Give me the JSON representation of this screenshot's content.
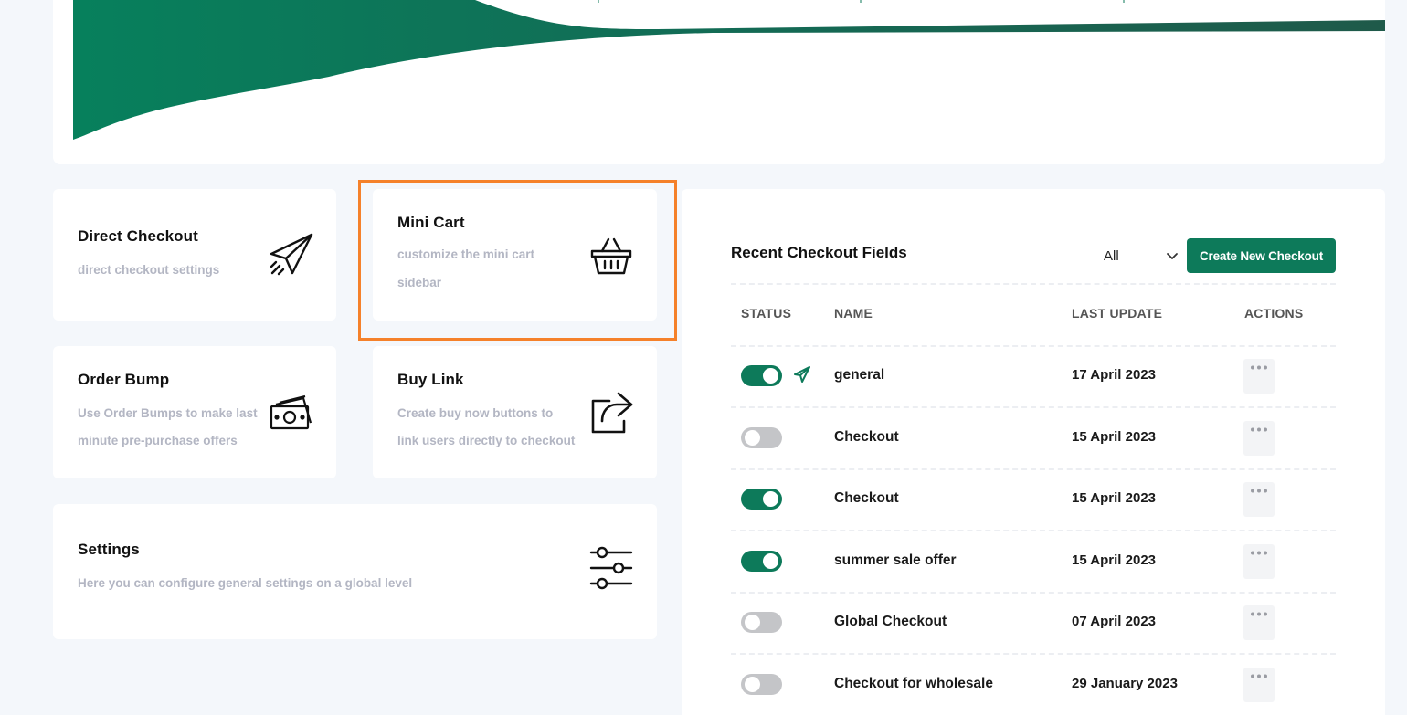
{
  "cards": {
    "direct_checkout": {
      "title": "Direct Checkout",
      "desc": "direct checkout settings",
      "icon": "paper-plane-icon"
    },
    "mini_cart": {
      "title": "Mini Cart",
      "desc_line1": "customize the mini cart",
      "desc_line2": "sidebar",
      "icon": "basket-icon"
    },
    "order_bump": {
      "title": "Order Bump",
      "desc_line1": "Use Order Bumps to make last",
      "desc_line2": "minute pre-purchase offers",
      "icon": "money-icon"
    },
    "buy_link": {
      "title": "Buy Link",
      "desc_line1": "Create buy now buttons to",
      "desc_line2": "link users directly to checkout",
      "icon": "share-icon"
    },
    "settings": {
      "title": "Settings",
      "desc": "Here you can configure general settings on a global level",
      "icon": "sliders-icon"
    }
  },
  "table": {
    "title": "Recent Checkout Fields",
    "filter_value": "All",
    "create_button": "Create New Checkout",
    "headers": {
      "status": "STATUS",
      "name": "NAME",
      "last_update": "LAST UPDATE",
      "actions": "ACTIONS"
    },
    "rows": [
      {
        "enabled": true,
        "name": "general",
        "date": "17 April 2023",
        "icon": "airplane-icon"
      },
      {
        "enabled": false,
        "name": "Checkout",
        "date": "15 April 2023"
      },
      {
        "enabled": true,
        "name": "Checkout",
        "date": "15 April 2023"
      },
      {
        "enabled": true,
        "name": "summer sale offer",
        "date": "15 April 2023"
      },
      {
        "enabled": false,
        "name": "Global Checkout",
        "date": "07 April 2023"
      },
      {
        "enabled": false,
        "name": "Checkout for wholesale",
        "date": "29 January 2023"
      }
    ]
  },
  "colors": {
    "brand": "#0d7a5a",
    "highlight": "#f5812a",
    "toggle_off": "#c4c5c8",
    "muted_text": "#b3b6c3"
  }
}
